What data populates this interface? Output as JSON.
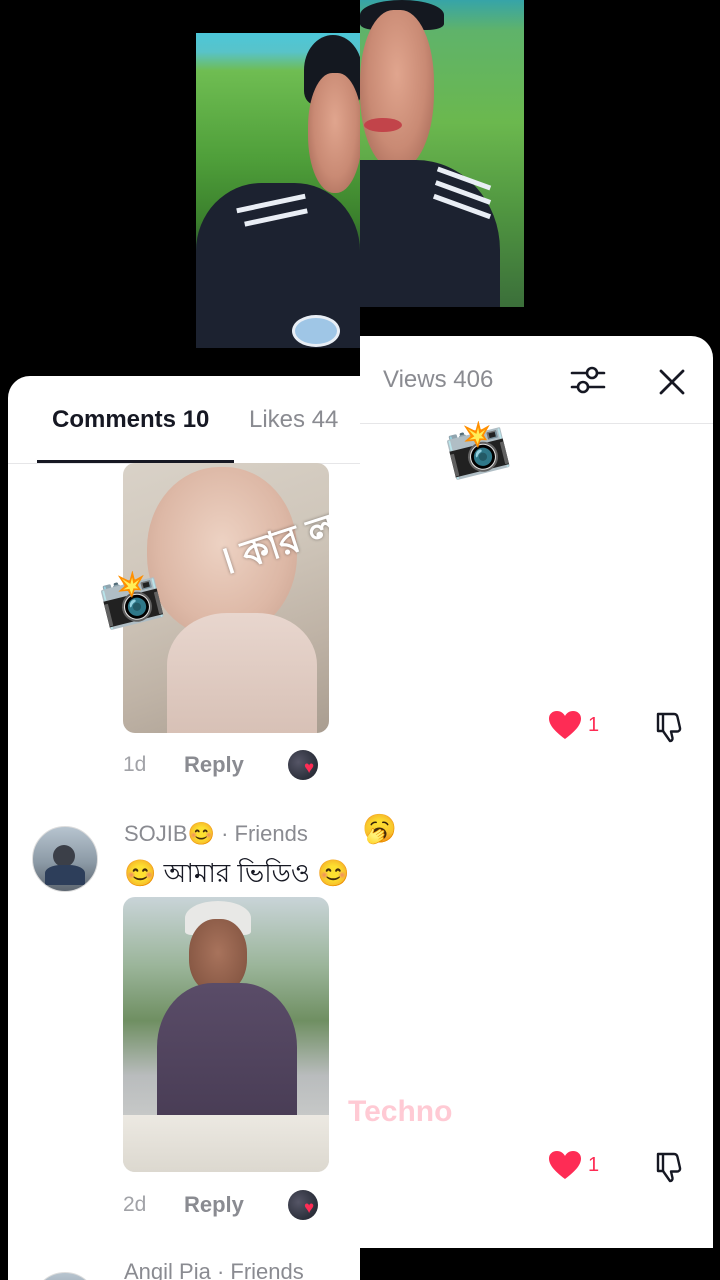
{
  "tabs": {
    "comments": "Comments 10",
    "likes": "Likes 44"
  },
  "panel": {
    "views": "Views 406"
  },
  "comments": [
    {
      "overlay_text": "। কার ল",
      "time": "1d",
      "reply": "Reply",
      "likes": "1"
    },
    {
      "username": "SOJIB😊 · Friends",
      "text": "😊 আমার ভিডিও 😊",
      "time": "2d",
      "reply": "Reply",
      "likes": "1"
    },
    {
      "username": "Angil Pia · Friends"
    }
  ],
  "watermark": "Techno",
  "emojis": {
    "camera": "📸",
    "yawn": "🥱"
  },
  "colors": {
    "accent": "#fe2c55",
    "text": "#161823",
    "muted": "#8a8b91"
  }
}
